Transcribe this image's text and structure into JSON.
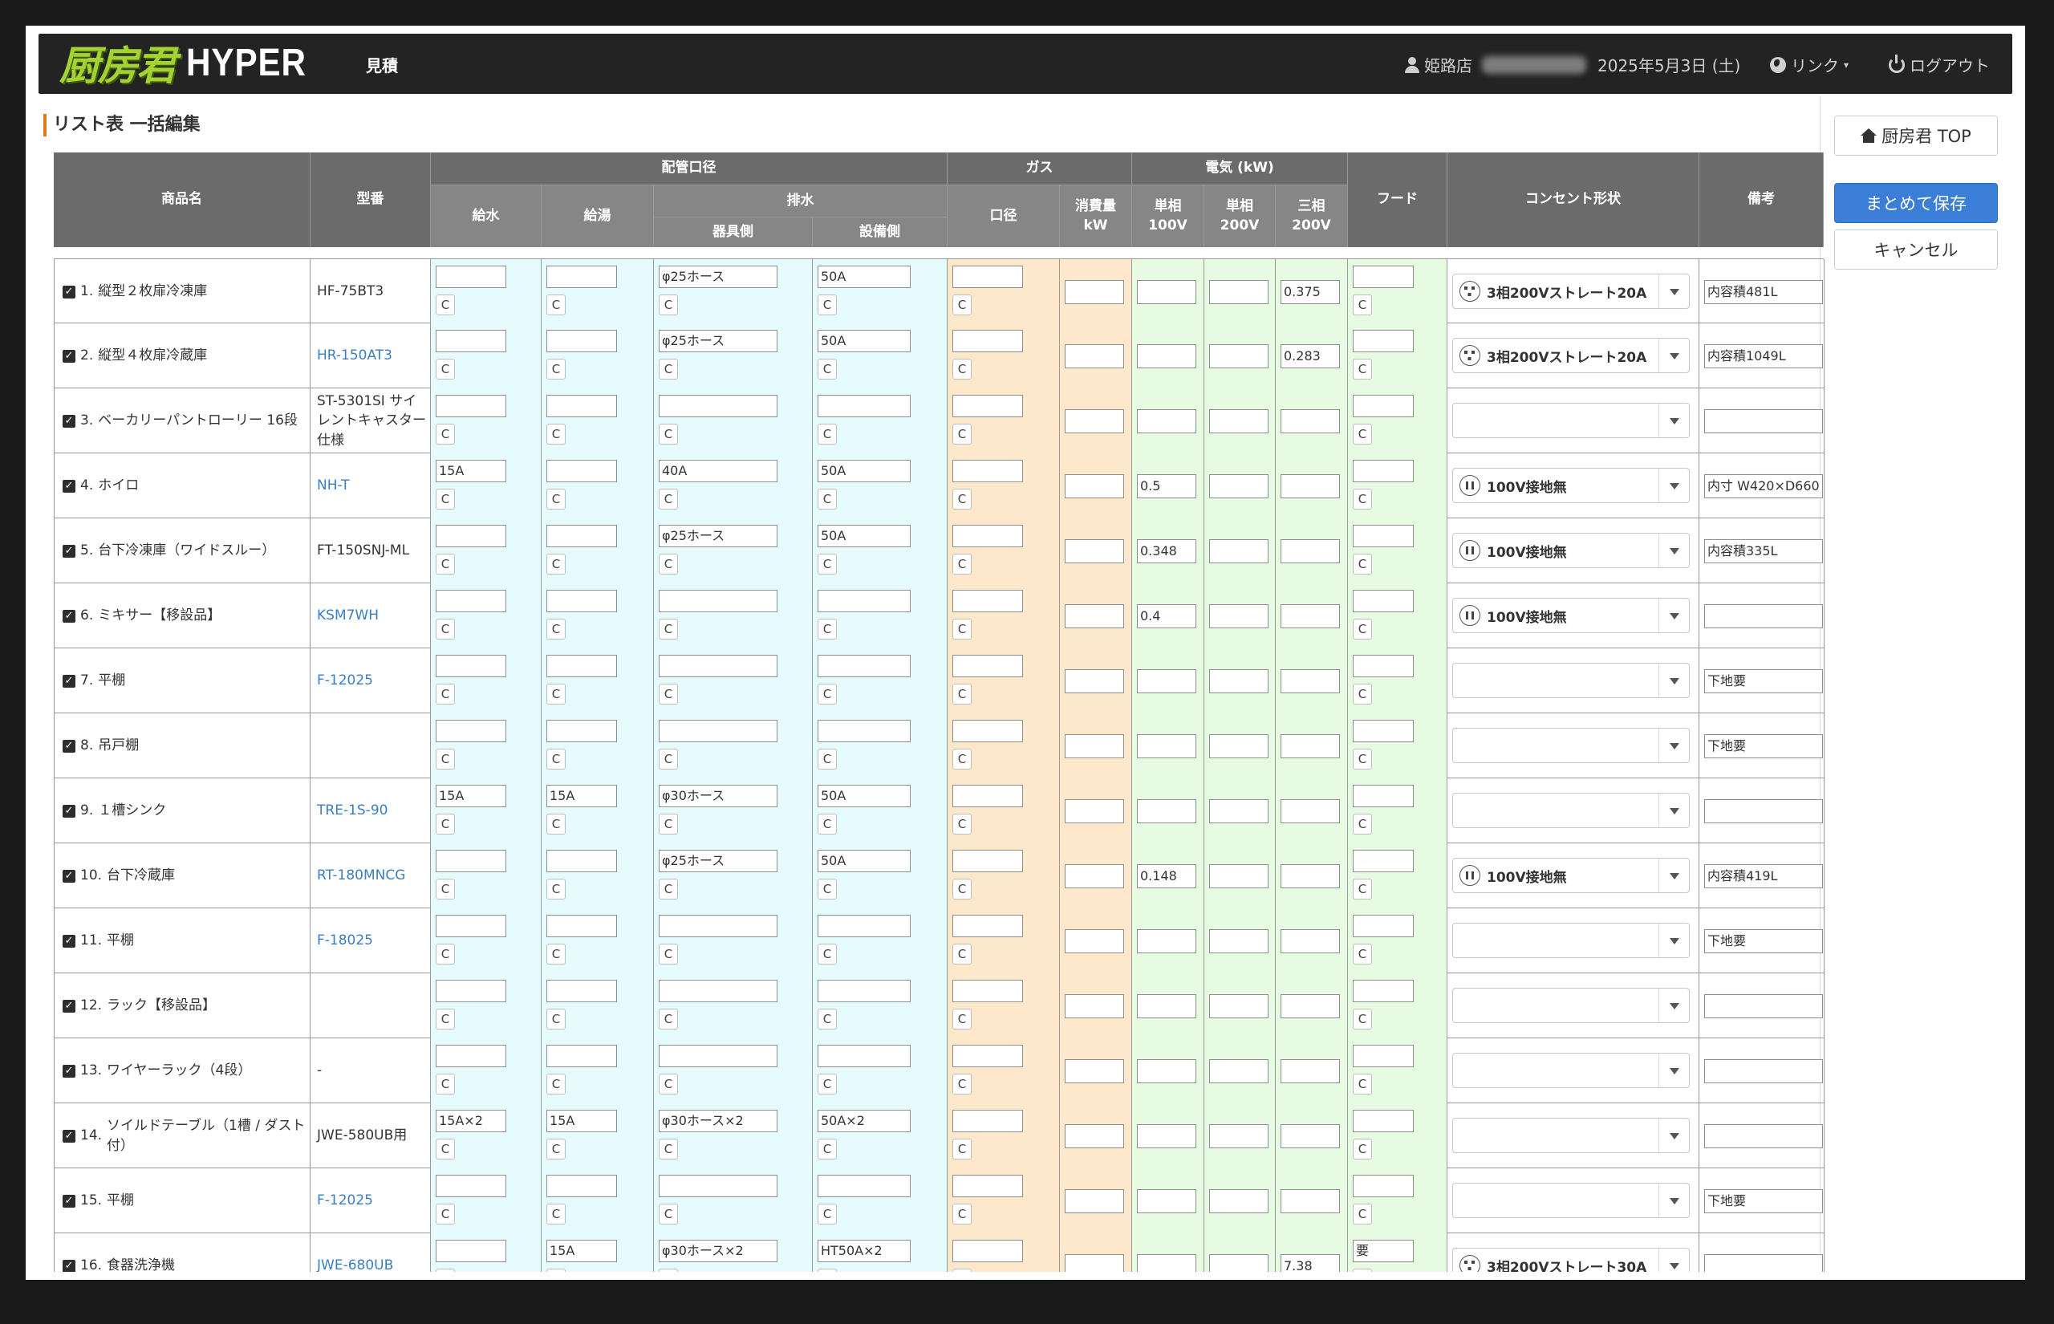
{
  "header": {
    "logo_kanji": "厨房君",
    "logo_hyper": "HYPER",
    "section": "見積",
    "store": "姫路店",
    "date": "2025年5月3日 (土)",
    "link": "リンク",
    "logout": "ログアウト"
  },
  "page_title": "リスト表 一括編集",
  "side": {
    "top_label": "厨房君 TOP",
    "save_label": "まとめて保存",
    "cancel_label": "キャンセル"
  },
  "columns": {
    "name": "商品名",
    "model": "型番",
    "pipe_group": "配管口径",
    "water": "給水",
    "hotwater": "給湯",
    "drain": "排水",
    "drain_fixture": "器具側",
    "drain_facility": "設備側",
    "gas_group": "ガス",
    "gas_bore": "口径",
    "gas_kw": "消費量\nkW",
    "elec_group": "電気 (kW)",
    "e100": "単相\n100V",
    "e200": "単相\n200V",
    "e3": "三相\n200V",
    "hood": "フード",
    "outlet": "コンセント形状",
    "remarks": "備考"
  },
  "c_label": "C",
  "rows": [
    {
      "no": "1.",
      "name": "縦型２枚扉冷凍庫",
      "model": "HF-75BT3",
      "link": false,
      "water": "",
      "hot": "",
      "drain1": "φ25ホース",
      "drain2": "50A",
      "gas": "",
      "gkw": "",
      "e100": "",
      "e200": "",
      "e3": "0.375",
      "hood": "",
      "outlet": "3相200Vストレート20A",
      "plug": "p3",
      "rem": "内容積481L"
    },
    {
      "no": "2.",
      "name": "縦型４枚扉冷蔵庫",
      "model": "HR-150AT3",
      "link": true,
      "water": "",
      "hot": "",
      "drain1": "φ25ホース",
      "drain2": "50A",
      "gas": "",
      "gkw": "",
      "e100": "",
      "e200": "",
      "e3": "0.283",
      "hood": "",
      "outlet": "3相200Vストレート20A",
      "plug": "p3",
      "rem": "内容積1049L"
    },
    {
      "no": "3.",
      "name": "ベーカリーパントローリー 16段",
      "model": "ST-5301SI サイレントキャスター仕様",
      "link": false,
      "water": "",
      "hot": "",
      "drain1": "",
      "drain2": "",
      "gas": "",
      "gkw": "",
      "e100": "",
      "e200": "",
      "e3": "",
      "hood": "",
      "outlet": "",
      "plug": "",
      "rem": ""
    },
    {
      "no": "4.",
      "name": "ホイロ",
      "model": "NH-T",
      "link": true,
      "water": "15A",
      "hot": "",
      "drain1": "40A",
      "drain2": "50A",
      "gas": "",
      "gkw": "",
      "e100": "0.5",
      "e200": "",
      "e3": "",
      "hood": "",
      "outlet": "100V接地無",
      "plug": "p2",
      "rem": "内寸 W420×D660"
    },
    {
      "no": "5.",
      "name": "台下冷凍庫（ワイドスルー）",
      "model": "FT-150SNJ-ML",
      "link": false,
      "water": "",
      "hot": "",
      "drain1": "φ25ホース",
      "drain2": "50A",
      "gas": "",
      "gkw": "",
      "e100": "0.348",
      "e200": "",
      "e3": "",
      "hood": "",
      "outlet": "100V接地無",
      "plug": "p2",
      "rem": "内容積335L"
    },
    {
      "no": "6.",
      "name": "ミキサー【移設品】",
      "model": "KSM7WH",
      "link": true,
      "water": "",
      "hot": "",
      "drain1": "",
      "drain2": "",
      "gas": "",
      "gkw": "",
      "e100": "0.4",
      "e200": "",
      "e3": "",
      "hood": "",
      "outlet": "100V接地無",
      "plug": "p2",
      "rem": ""
    },
    {
      "no": "7.",
      "name": "平棚",
      "model": "F-12025",
      "link": true,
      "water": "",
      "hot": "",
      "drain1": "",
      "drain2": "",
      "gas": "",
      "gkw": "",
      "e100": "",
      "e200": "",
      "e3": "",
      "hood": "",
      "outlet": "",
      "plug": "",
      "rem": "下地要"
    },
    {
      "no": "8.",
      "name": "吊戸棚",
      "model": "",
      "link": false,
      "water": "",
      "hot": "",
      "drain1": "",
      "drain2": "",
      "gas": "",
      "gkw": "",
      "e100": "",
      "e200": "",
      "e3": "",
      "hood": "",
      "outlet": "",
      "plug": "",
      "rem": "下地要"
    },
    {
      "no": "9.",
      "name": "１槽シンク",
      "model": "TRE-1S-90",
      "link": true,
      "water": "15A",
      "hot": "15A",
      "drain1": "φ30ホース",
      "drain2": "50A",
      "gas": "",
      "gkw": "",
      "e100": "",
      "e200": "",
      "e3": "",
      "hood": "",
      "outlet": "",
      "plug": "",
      "rem": ""
    },
    {
      "no": "10.",
      "name": "台下冷蔵庫",
      "model": "RT-180MNCG",
      "link": true,
      "water": "",
      "hot": "",
      "drain1": "φ25ホース",
      "drain2": "50A",
      "gas": "",
      "gkw": "",
      "e100": "0.148",
      "e200": "",
      "e3": "",
      "hood": "",
      "outlet": "100V接地無",
      "plug": "p2",
      "rem": "内容積419L"
    },
    {
      "no": "11.",
      "name": "平棚",
      "model": "F-18025",
      "link": true,
      "water": "",
      "hot": "",
      "drain1": "",
      "drain2": "",
      "gas": "",
      "gkw": "",
      "e100": "",
      "e200": "",
      "e3": "",
      "hood": "",
      "outlet": "",
      "plug": "",
      "rem": "下地要"
    },
    {
      "no": "12.",
      "name": "ラック【移設品】",
      "model": "",
      "link": false,
      "water": "",
      "hot": "",
      "drain1": "",
      "drain2": "",
      "gas": "",
      "gkw": "",
      "e100": "",
      "e200": "",
      "e3": "",
      "hood": "",
      "outlet": "",
      "plug": "",
      "rem": ""
    },
    {
      "no": "13.",
      "name": "ワイヤーラック（4段）",
      "model": "-",
      "link": false,
      "water": "",
      "hot": "",
      "drain1": "",
      "drain2": "",
      "gas": "",
      "gkw": "",
      "e100": "",
      "e200": "",
      "e3": "",
      "hood": "",
      "outlet": "",
      "plug": "",
      "rem": ""
    },
    {
      "no": "14.",
      "name": "ソイルドテーブル（1槽 / ダスト付）",
      "model": "JWE-580UB用",
      "link": false,
      "water": "15A×2",
      "hot": "15A",
      "drain1": "φ30ホース×2",
      "drain2": "50A×2",
      "gas": "",
      "gkw": "",
      "e100": "",
      "e200": "",
      "e3": "",
      "hood": "",
      "outlet": "",
      "plug": "",
      "rem": ""
    },
    {
      "no": "15.",
      "name": "平棚",
      "model": "F-12025",
      "link": true,
      "water": "",
      "hot": "",
      "drain1": "",
      "drain2": "",
      "gas": "",
      "gkw": "",
      "e100": "",
      "e200": "",
      "e3": "",
      "hood": "",
      "outlet": "",
      "plug": "",
      "rem": "下地要"
    },
    {
      "no": "16.",
      "name": "食器洗浄機",
      "model": "JWE-680UB",
      "link": true,
      "water": "",
      "hot": "15A",
      "drain1": "φ30ホース×2",
      "drain2": "HT50A×2",
      "gas": "",
      "gkw": "",
      "e100": "",
      "e200": "",
      "e3": "7.38",
      "hood": "要",
      "outlet": "3相200Vストレート30A",
      "plug": "p3",
      "rem": ""
    }
  ]
}
